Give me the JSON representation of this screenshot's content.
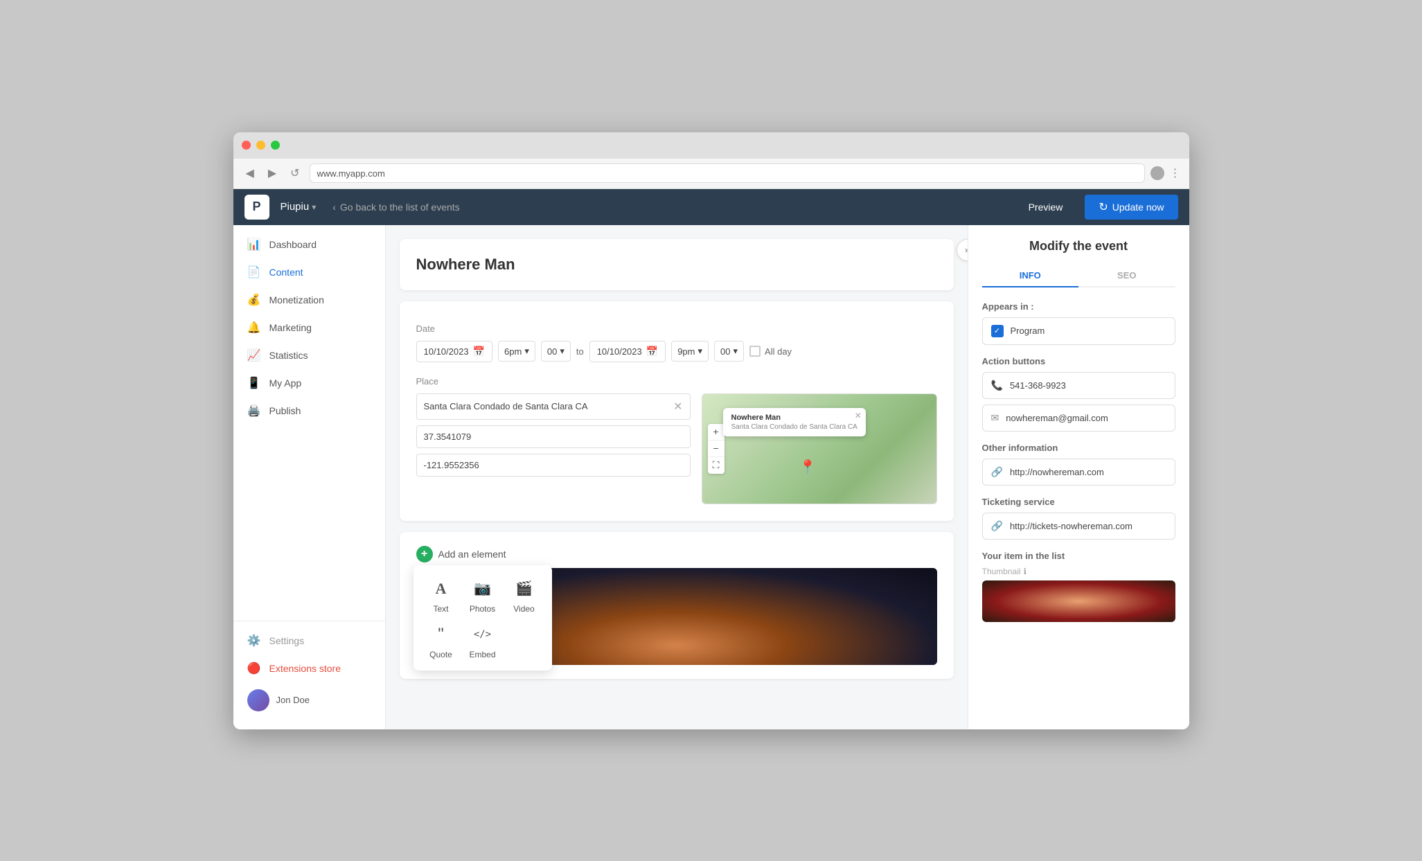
{
  "browser": {
    "url": "www.myapp.com",
    "back_icon": "◀",
    "forward_icon": "▶",
    "refresh_icon": "↺",
    "menu_icon": "⋮"
  },
  "app": {
    "logo_letter": "P",
    "brand_name": "Piupiu",
    "brand_chevron": "▾",
    "breadcrumb_icon": "‹",
    "breadcrumb_text": "Go back to the list of events",
    "preview_label": "Preview",
    "update_label": "Update now",
    "update_icon": "↻"
  },
  "sidebar": {
    "items": [
      {
        "id": "dashboard",
        "label": "Dashboard",
        "icon": "📊"
      },
      {
        "id": "content",
        "label": "Content",
        "icon": "📄"
      },
      {
        "id": "monetization",
        "label": "Monetization",
        "icon": "💰"
      },
      {
        "id": "marketing",
        "label": "Marketing",
        "icon": "🔔"
      },
      {
        "id": "statistics",
        "label": "Statistics",
        "icon": "📈"
      },
      {
        "id": "myapp",
        "label": "My App",
        "icon": "📱"
      },
      {
        "id": "publish",
        "label": "Publish",
        "icon": "🖨️"
      }
    ],
    "footer": [
      {
        "id": "settings",
        "label": "Settings",
        "icon": "⚙️"
      },
      {
        "id": "extensions",
        "label": "Extensions store",
        "icon": "🔴"
      }
    ],
    "user": {
      "name": "Jon Doe"
    }
  },
  "event": {
    "title": "Nowhere Man",
    "date": {
      "label": "Date",
      "start_date": "10/10/2023",
      "start_time": "6pm",
      "start_min": "00",
      "to_label": "to",
      "end_date": "10/10/2023",
      "end_time": "9pm",
      "end_min": "00",
      "all_day_label": "All day"
    },
    "place": {
      "label": "Place",
      "address": "Santa Clara Condado de Santa Clara CA",
      "lat": "37.3541079",
      "lng": "-121.9552356"
    },
    "map_popup": {
      "title": "Nowhere Man",
      "subtitle": "Santa Clara Condado de Santa Clara CA"
    }
  },
  "add_element": {
    "label": "Add an element",
    "items": [
      {
        "id": "text",
        "label": "Text",
        "icon": "A"
      },
      {
        "id": "photos",
        "label": "Photos",
        "icon": "📷"
      },
      {
        "id": "video",
        "label": "Video",
        "icon": "🎬"
      },
      {
        "id": "quote",
        "label": "Quote",
        "icon": "❝"
      },
      {
        "id": "embed",
        "label": "Embed",
        "icon": "</>"
      }
    ]
  },
  "right_panel": {
    "title": "Modify the event",
    "tabs": [
      {
        "id": "info",
        "label": "INFO"
      },
      {
        "id": "seo",
        "label": "SEO"
      }
    ],
    "appears_in_label": "Appears in :",
    "appears_in_value": "Program",
    "action_buttons_label": "Action buttons",
    "phone": "541-368-9923",
    "email": "nowhereman@gmail.com",
    "other_info_label": "Other information",
    "website": "http://nowhereman.com",
    "ticketing_label": "Ticketing service",
    "ticketing_url": "http://tickets-nowhereman.com",
    "list_label": "Your item in the list",
    "thumbnail_label": "Thumbnail",
    "thumbnail_info_icon": "ℹ"
  }
}
